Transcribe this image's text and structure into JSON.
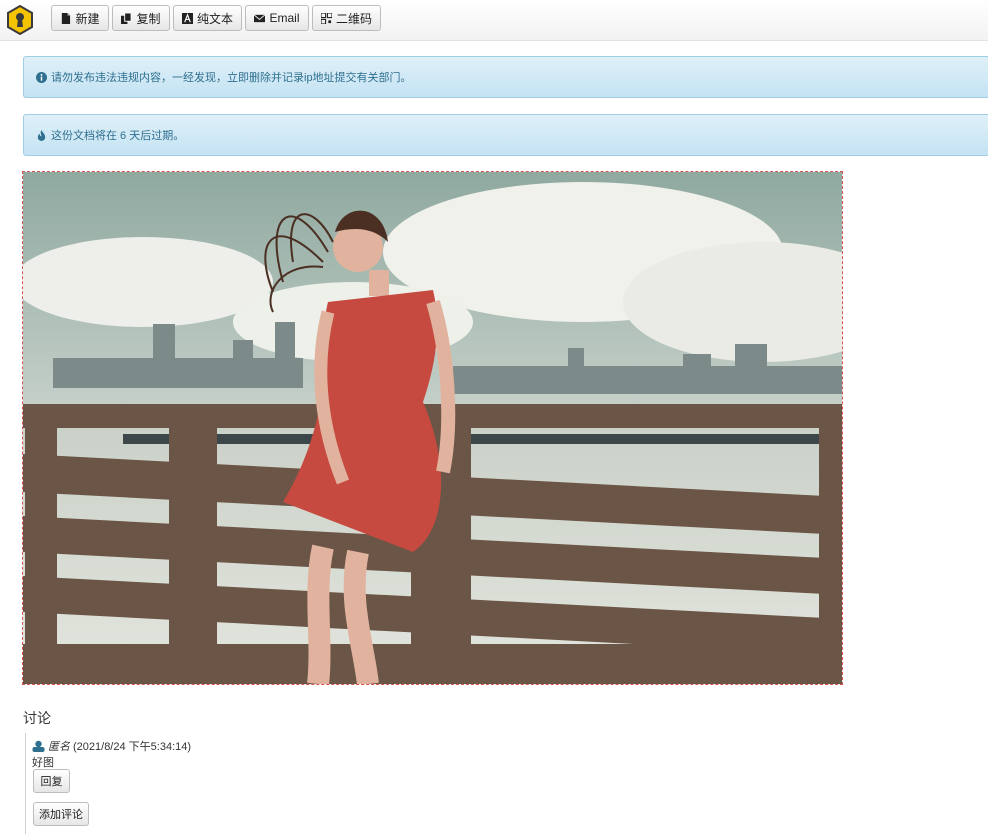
{
  "toolbar": {
    "new_label": "新建",
    "copy_label": "复制",
    "plaintext_label": "纯文本",
    "email_label": "Email",
    "qrcode_label": "二维码"
  },
  "alerts": {
    "warning_text": "请勿发布违法违规内容，一经发现，立即删除并记录ip地址提交有关部门。",
    "expiry_text": "这份文档将在 6 天后过期。"
  },
  "discussion": {
    "title": "讨论",
    "comments": [
      {
        "author": "匿名",
        "timestamp": "(2021/8/24 下午5:34:14)",
        "body": "好图",
        "reply_label": "回复"
      }
    ],
    "add_comment_label": "添加评论"
  },
  "colors": {
    "alert_bg": "#d6ebf6",
    "alert_text": "#2f6f8f",
    "image_border": "#d9534f",
    "logo_yellow": "#f5c400"
  },
  "icons": {
    "logo": "keyhole-hexagon-logo",
    "new": "file-icon",
    "copy": "copy-icon",
    "plaintext": "font-icon",
    "email": "envelope-icon",
    "qrcode": "qrcode-icon",
    "warning": "info-circle-icon",
    "expiry": "fire-icon",
    "commenter": "user-icon"
  }
}
